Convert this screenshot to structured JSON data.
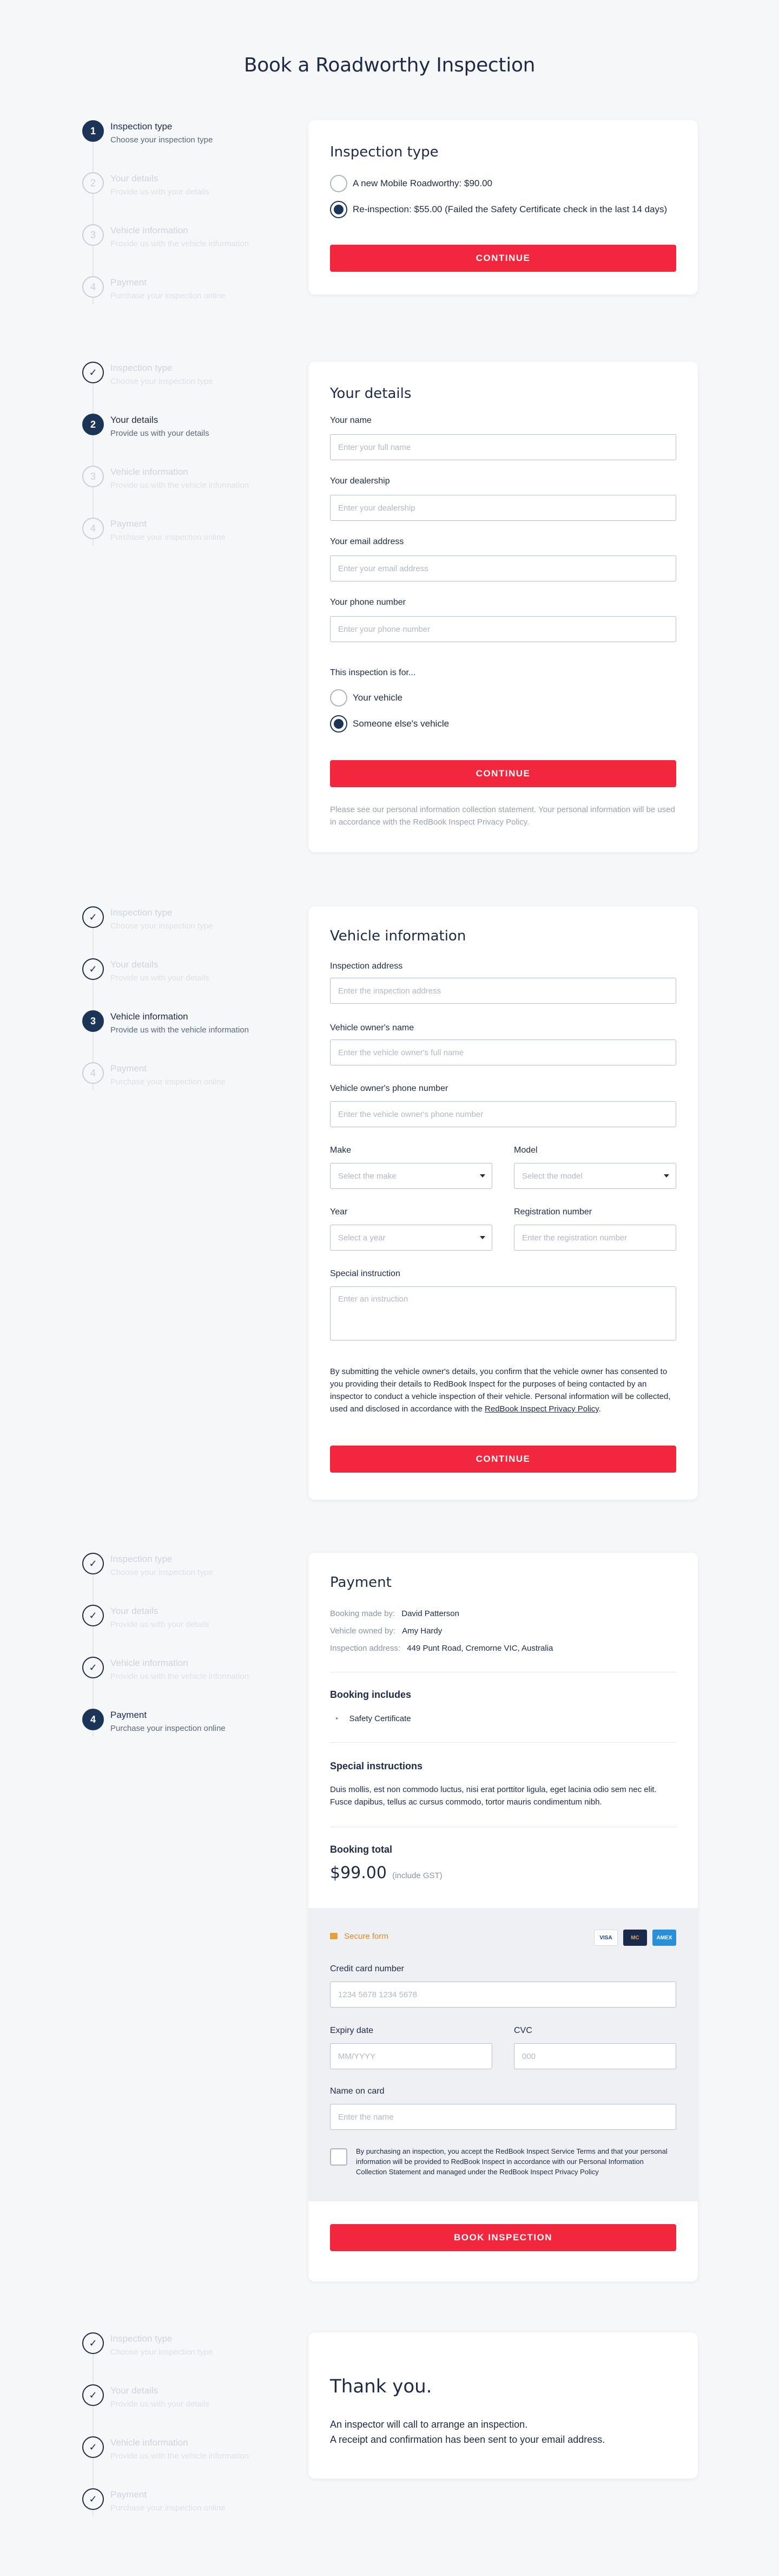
{
  "page": {
    "title": "Book a Roadworthy Inspection"
  },
  "steps": [
    {
      "number": "1",
      "title": "Inspection type",
      "subtitle": "Choose your inspection type"
    },
    {
      "number": "2",
      "title": "Your details",
      "subtitle": "Provide us with your details"
    },
    {
      "number": "3",
      "title": "Vehicle information",
      "subtitle": "Provide us with the vehicle information"
    },
    {
      "number": "4",
      "title": "Payment",
      "subtitle": "Purchase your inspection online"
    }
  ],
  "inspection_type": {
    "heading": "Inspection type",
    "options": [
      {
        "label": "A new Mobile Roadworthy: $90.00",
        "checked": false
      },
      {
        "label": "Re-inspection: $55.00 (Failed the Safety Certificate check in the last 14 days)",
        "checked": true
      }
    ],
    "button": "CONTINUE"
  },
  "your_details": {
    "heading": "Your details",
    "name_label": "Your name",
    "name_placeholder": "Enter your full name",
    "dealership_label": "Your dealership",
    "dealership_placeholder": "Enter your dealership",
    "email_label": "Your email address",
    "email_placeholder": "Enter your email address",
    "phone_label": "Your phone number",
    "phone_placeholder": "Enter your phone number",
    "for_label": "This inspection is for...",
    "for_options": [
      {
        "label": "Your vehicle",
        "checked": false
      },
      {
        "label": "Someone else's vehicle",
        "checked": true
      }
    ],
    "button": "CONTINUE",
    "privacy_note": "Please see our personal information collection statement. Your personal information will be used in accordance with the RedBook Inspect Privacy Policy."
  },
  "vehicle": {
    "heading": "Vehicle information",
    "address_label": "Inspection address",
    "address_placeholder": "Enter the inspection address",
    "owner_name_label": "Vehicle owner's name",
    "owner_name_placeholder": "Enter the vehicle owner's full name",
    "owner_phone_label": "Vehicle owner's phone number",
    "owner_phone_placeholder": "Enter the vehicle owner's phone number",
    "make_label": "Make",
    "make_placeholder": "Select the make",
    "model_label": "Model",
    "model_placeholder": "Select the model",
    "year_label": "Year",
    "year_placeholder": "Select a year",
    "rego_label": "Registration number",
    "rego_placeholder": "Enter the registration number",
    "instruction_label": "Special instruction",
    "instruction_placeholder": "Enter an instruction",
    "consent_text": "By submitting the vehicle owner's details, you confirm that the vehicle owner has consented to you providing their details to RedBook Inspect for the purposes of being contacted by an inspector to conduct a vehicle inspection of their vehicle. Personal information will be collected, used and disclosed in accordance with the ",
    "consent_link": "RedBook Inspect Privacy Policy",
    "consent_end": ".",
    "button": "CONTINUE"
  },
  "payment": {
    "heading": "Payment",
    "booking_made_by_label": "Booking made by:",
    "booking_made_by": "David Patterson",
    "owned_by_label": "Vehicle owned by:",
    "owned_by": "Amy Hardy",
    "address_label": "Inspection address:",
    "address": "449 Punt Road, Cremorne VIC, Australia",
    "includes_heading": "Booking includes",
    "includes_item": "Safety Certificate",
    "instructions_heading": "Special instructions",
    "instructions_text": "Duis mollis, est non commodo luctus, nisi erat porttitor ligula, eget lacinia odio sem nec elit. Fusce dapibus, tellus ac cursus commodo, tortor mauris condimentum nibh.",
    "total_heading": "Booking total",
    "total": "$99.00",
    "total_note": "(include GST)",
    "secure_label": "Secure form",
    "card_brands": [
      "VISA",
      "MC",
      "AMEX"
    ],
    "cc_label": "Credit card number",
    "cc_placeholder": "1234 5678 1234 5678",
    "expiry_label": "Expiry date",
    "expiry_placeholder": "MM/YYYY",
    "cvc_label": "CVC",
    "cvc_placeholder": "000",
    "name_label": "Name on card",
    "name_placeholder": "Enter the name",
    "terms_text": "By purchasing an inspection, you accept the RedBook Inspect Service Terms and that your personal information will be provided to RedBook Inspect in accordance with our Personal Information Collection Statement and managed under the RedBook Inspect Privacy Policy",
    "button": "BOOK INSPECTION"
  },
  "thanks": {
    "heading": "Thank you.",
    "line1": "An inspector will call to arrange an inspection.",
    "line2": "A receipt and confirmation has been sent to your email address."
  },
  "colors": {
    "accent": "#f2273e",
    "navy": "#1c3557",
    "background": "#f6f7f9"
  }
}
